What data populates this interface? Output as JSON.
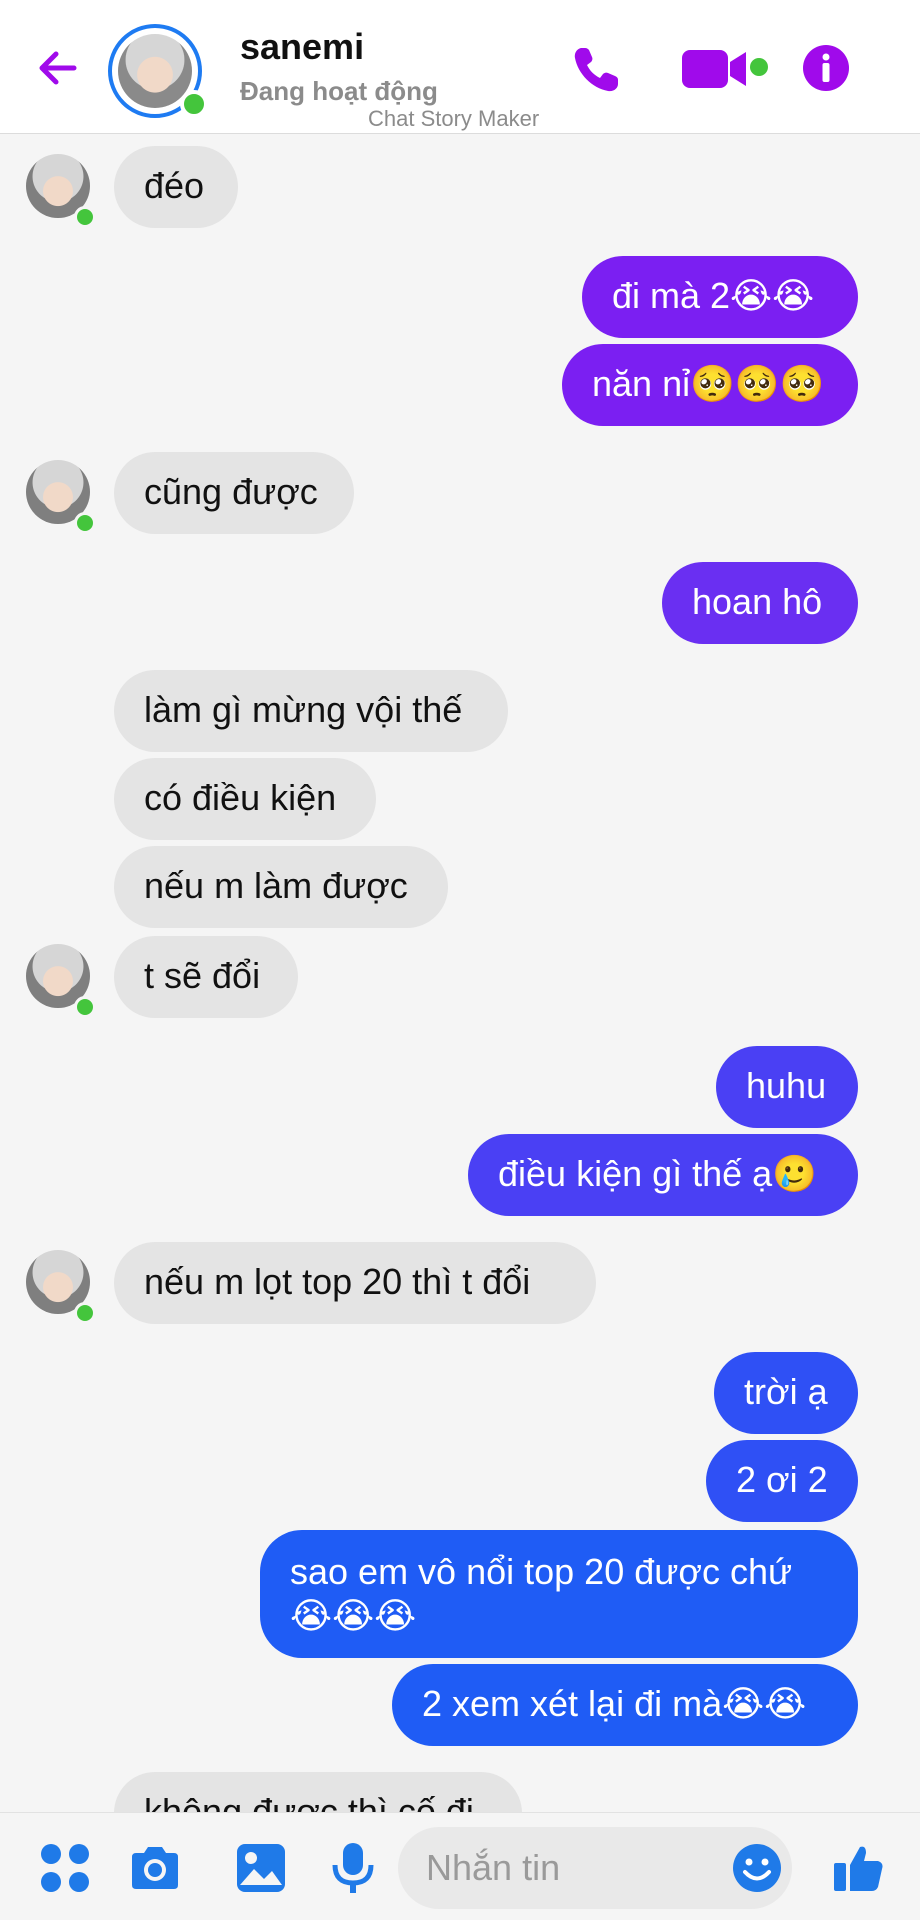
{
  "colors": {
    "accent": "#a00aeb",
    "outgoing_purple": "#7b1ff2",
    "outgoing_blue": "#1f5cf5",
    "incoming": "#e4e4e4",
    "online": "#44c53c"
  },
  "header": {
    "contact_name": "sanemi",
    "status": "Đang hoạt động",
    "watermark": "Chat Story Maker"
  },
  "messages": [
    {
      "dir": "in",
      "text": "đéo",
      "avatar": true
    },
    {
      "dir": "out",
      "text": "đi mà 2😭😭",
      "tone": "purple"
    },
    {
      "dir": "out",
      "text": "năn nỉ🥺🥺🥺",
      "tone": "purple"
    },
    {
      "dir": "in",
      "text": "cũng được",
      "avatar": true
    },
    {
      "dir": "out",
      "text": "hoan hô",
      "tone": "purple"
    },
    {
      "dir": "in",
      "text": "làm gì mừng vội thế",
      "avatar": false
    },
    {
      "dir": "in",
      "text": "có điều kiện",
      "avatar": false
    },
    {
      "dir": "in",
      "text": "nếu m làm được",
      "avatar": false
    },
    {
      "dir": "in",
      "text": "t sẽ đổi",
      "avatar": true
    },
    {
      "dir": "out",
      "text": "huhu",
      "tone": "indigo"
    },
    {
      "dir": "out",
      "text": "điều kiện gì thế ạ🥲",
      "tone": "indigo"
    },
    {
      "dir": "in",
      "text": "nếu m lọt top 20  thì t đổi",
      "avatar": true
    },
    {
      "dir": "out",
      "text": "trời ạ",
      "tone": "blue"
    },
    {
      "dir": "out",
      "text": "2 ơi 2",
      "tone": "blue"
    },
    {
      "dir": "out",
      "text": "sao em vô nổi top 20 được chứ\n😭😭😭",
      "tone": "blue"
    },
    {
      "dir": "out",
      "text": "2 xem xét lại đi mà😭😭",
      "tone": "blue"
    },
    {
      "dir": "in",
      "text": "không được thì cố đi",
      "avatar": false
    }
  ],
  "composer": {
    "placeholder": "Nhắn tin"
  },
  "icons": {
    "back": "arrow-left-icon",
    "call": "phone-icon",
    "video": "video-camera-icon",
    "info": "info-icon",
    "apps": "four-dots-icon",
    "camera": "camera-icon",
    "gallery": "image-icon",
    "mic": "microphone-icon",
    "emoji": "smiley-icon",
    "like": "thumbs-up-icon"
  }
}
